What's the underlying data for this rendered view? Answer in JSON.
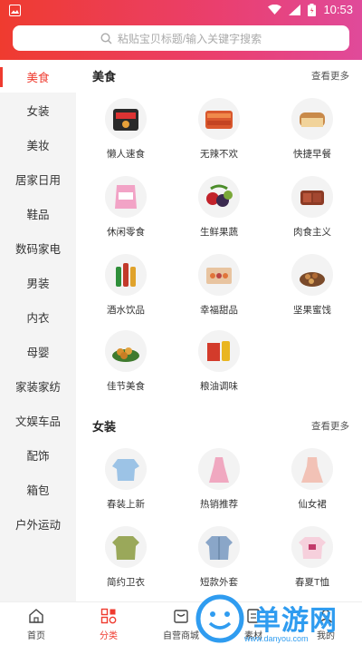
{
  "status": {
    "time": "10:53"
  },
  "search": {
    "placeholder": "粘贴宝贝标题/输入关键字搜索"
  },
  "sidebar": {
    "items": [
      {
        "label": "美食"
      },
      {
        "label": "女装"
      },
      {
        "label": "美妆"
      },
      {
        "label": "居家日用"
      },
      {
        "label": "鞋品"
      },
      {
        "label": "数码家电"
      },
      {
        "label": "男装"
      },
      {
        "label": "内衣"
      },
      {
        "label": "母婴"
      },
      {
        "label": "家装家纺"
      },
      {
        "label": "文娱车品"
      },
      {
        "label": "配饰"
      },
      {
        "label": "箱包"
      },
      {
        "label": "户外运动"
      }
    ]
  },
  "sections": [
    {
      "title": "美食",
      "more": "查看更多",
      "items": [
        {
          "label": "懒人速食",
          "icon": "instant-food-icon"
        },
        {
          "label": "无辣不欢",
          "icon": "spicy-meat-icon"
        },
        {
          "label": "快捷早餐",
          "icon": "bread-icon"
        },
        {
          "label": "休闲零食",
          "icon": "snack-bag-icon"
        },
        {
          "label": "生鲜果蔬",
          "icon": "fruit-icon"
        },
        {
          "label": "肉食主义",
          "icon": "meat-icon"
        },
        {
          "label": "酒水饮品",
          "icon": "bottles-icon"
        },
        {
          "label": "幸福甜品",
          "icon": "dessert-box-icon"
        },
        {
          "label": "坚果蜜饯",
          "icon": "nuts-icon"
        },
        {
          "label": "佳节美食",
          "icon": "festival-food-icon"
        },
        {
          "label": "粮油调味",
          "icon": "oil-rice-icon"
        }
      ]
    },
    {
      "title": "女装",
      "more": "查看更多",
      "items": [
        {
          "label": "春装上新",
          "icon": "blouse-icon"
        },
        {
          "label": "热销推荐",
          "icon": "pink-dress-icon"
        },
        {
          "label": "仙女裙",
          "icon": "fairy-dress-icon"
        },
        {
          "label": "简约卫衣",
          "icon": "hoodie-icon"
        },
        {
          "label": "短款外套",
          "icon": "denim-jacket-icon"
        },
        {
          "label": "春夏T恤",
          "icon": "tshirt-icon"
        }
      ]
    }
  ],
  "tabbar": {
    "items": [
      {
        "label": "首页"
      },
      {
        "label": "分类"
      },
      {
        "label": "自营商城"
      },
      {
        "label": "素材"
      },
      {
        "label": "我的"
      }
    ]
  },
  "watermark": {
    "text": "单游网",
    "url": "www.danyou.com"
  },
  "colors": {
    "accent": "#ef3b2f",
    "header_end": "#e04a9a",
    "watermark": "#2f9cf0"
  }
}
